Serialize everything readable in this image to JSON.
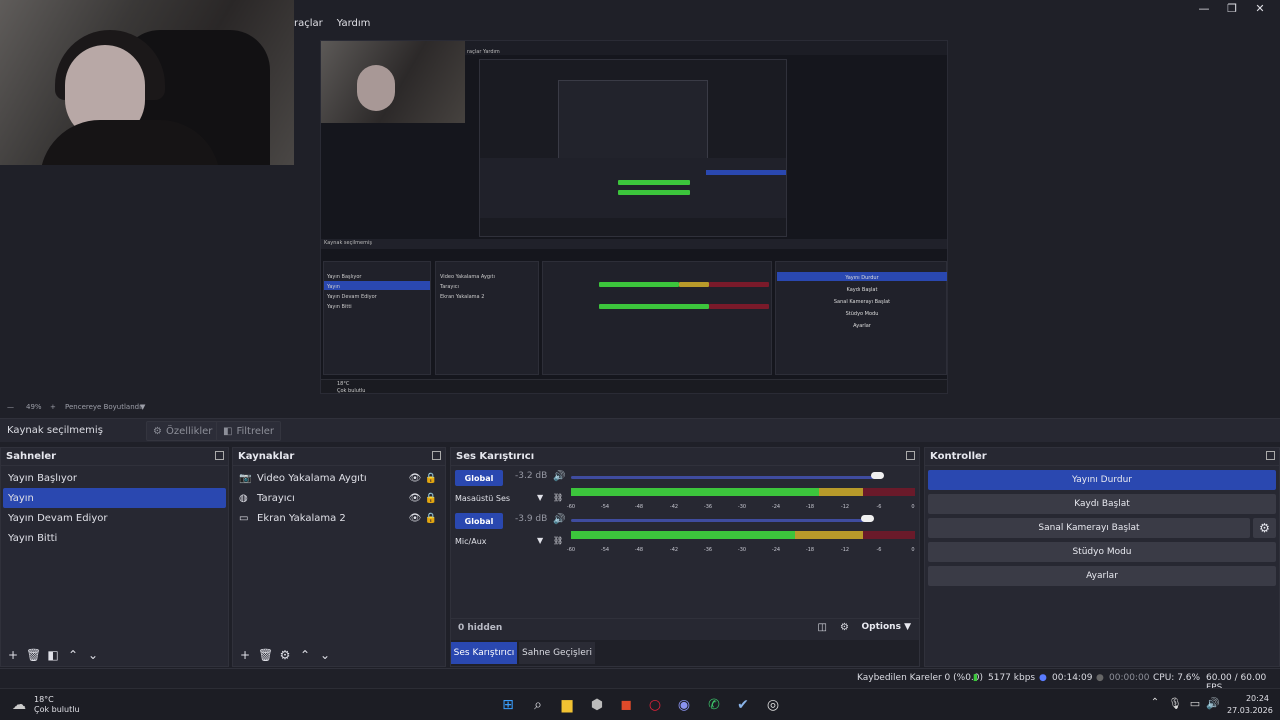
{
  "menu": {
    "items": [
      "raçlar",
      "Yardım"
    ]
  },
  "window": {
    "min": "—",
    "max": "❐",
    "close": "✕"
  },
  "preview": {
    "inner_menu": "raçlar   Yardım",
    "inner_sources_label": "Kaynak seçilmemiş",
    "inner_scenes": [
      "Yayın Başlıyor",
      "Yayın",
      "Yayın Devam Ediyor",
      "Yayın Bitti"
    ],
    "inner_sources": [
      "Video Yakalama Aygıtı",
      "Tarayıcı",
      "Ekran Yakalama 2"
    ],
    "inner_controls": [
      "Yayını Durdur",
      "Kaydı Başlat",
      "Sanal Kamerayı Başlat",
      "Stüdyo Modu",
      "Ayarlar"
    ],
    "inner_weather": "18°C",
    "inner_weather2": "Çok bulutlu"
  },
  "zoombar": {
    "minus": "—",
    "zoom": "49%",
    "plus": "+",
    "fit": "Pencereye Boyutlandır"
  },
  "sourcebar": {
    "label": "Kaynak seçilmemiş",
    "properties": "Özellikler",
    "filters": "Filtreler"
  },
  "scenes": {
    "title": "Sahneler",
    "items": [
      "Yayın Başlıyor",
      "Yayın",
      "Yayın Devam Ediyor",
      "Yayın Bitti"
    ],
    "selected": 1
  },
  "sources": {
    "title": "Kaynaklar",
    "items": [
      {
        "name": "Video Yakalama Aygıtı",
        "icon": "camera-icon"
      },
      {
        "name": "Tarayıcı",
        "icon": "globe-icon"
      },
      {
        "name": "Ekran Yakalama 2",
        "icon": "monitor-icon"
      }
    ]
  },
  "mixer": {
    "title": "Ses Karıştırıcı",
    "channels": [
      {
        "global": "Global",
        "db": "-3.2 dB",
        "name": "Masaüstü Ses",
        "volume": 0.89,
        "level_green": 0.72,
        "level_total": 0.93
      },
      {
        "global": "Global",
        "db": "-3.9 dB",
        "name": "Mic/Aux",
        "volume": 0.86,
        "level_green": 0.65,
        "level_total": 0.85
      }
    ],
    "ticks": [
      "-60",
      "-54",
      "-48",
      "-42",
      "-36",
      "-30",
      "-24",
      "-18",
      "-12",
      "-6",
      "0"
    ],
    "hidden": "0 hidden",
    "options": "Options",
    "tabs": [
      "Ses Karıştırıcı",
      "Sahne Geçişleri"
    ]
  },
  "controls": {
    "title": "Kontroller",
    "buttons": [
      "Yayını Durdur",
      "Kaydı Başlat",
      "Sanal Kamerayı Başlat",
      "Stüdyo Modu",
      "Ayarlar"
    ]
  },
  "status": {
    "dropped": "Kaybedilen Kareler 0 (%0.0)",
    "bitrate": "5177 kbps",
    "stream_time": "00:14:09",
    "rec_time": "00:00:00",
    "cpu": "CPU: 7.6%",
    "fps": "60.00 / 60.00 FPS"
  },
  "taskbar": {
    "temp": "18°C",
    "weather": "Çok bulutlu",
    "time": "20:24",
    "date": "27.03.2026"
  },
  "colors": {
    "accent": "#2a48b0",
    "bg": "#1f2028",
    "panel": "#272832",
    "green": "#3cc53c",
    "yellow": "#b89a2a",
    "red": "#c0203a"
  }
}
